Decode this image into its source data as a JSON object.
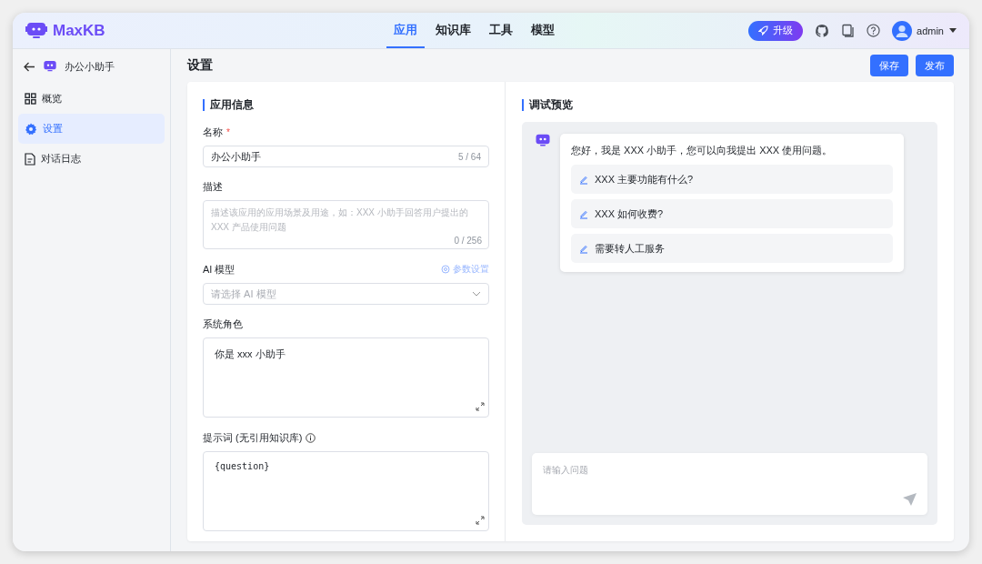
{
  "header": {
    "logo": "MaxKB",
    "nav": [
      {
        "label": "应用",
        "selected": true
      },
      {
        "label": "知识库",
        "selected": false
      },
      {
        "label": "工具",
        "selected": false
      },
      {
        "label": "模型",
        "selected": false
      }
    ],
    "upgrade": "升级",
    "user": "admin"
  },
  "sidebar": {
    "app_name": "办公小助手",
    "items": [
      {
        "label": "概览",
        "kind": "grid",
        "selected": false
      },
      {
        "label": "设置",
        "kind": "gear",
        "selected": true
      },
      {
        "label": "对话日志",
        "kind": "doc",
        "selected": false
      }
    ]
  },
  "page": {
    "title": "设置",
    "buttons": [
      "保存",
      "发布"
    ]
  },
  "app_info": {
    "heading": "应用信息",
    "name": {
      "label": "名称",
      "required_mark": "*",
      "value": "办公小助手",
      "counter": "5 / 64"
    },
    "description": {
      "label": "描述",
      "placeholder": "描述该应用的应用场景及用途，如：XXX 小助手回答用户提出的 XXX 产品使用问题",
      "counter": "0 / 256"
    },
    "model": {
      "label": "AI 模型",
      "link": "参数设置",
      "placeholder": "请选择 AI 模型"
    },
    "system_role": {
      "label": "系统角色",
      "value": "你是 xxx 小助手"
    },
    "prompt": {
      "label": "提示词 (无引用知识库)",
      "value": "{question}"
    }
  },
  "preview": {
    "heading": "调试预览",
    "greeting": "您好，我是 XXX 小助手，您可以向我提出 XXX 使用问题。",
    "suggestions": [
      "XXX 主要功能有什么?",
      "XXX 如何收费?",
      "需要转人工服务"
    ],
    "input_placeholder": "请输入问题"
  }
}
